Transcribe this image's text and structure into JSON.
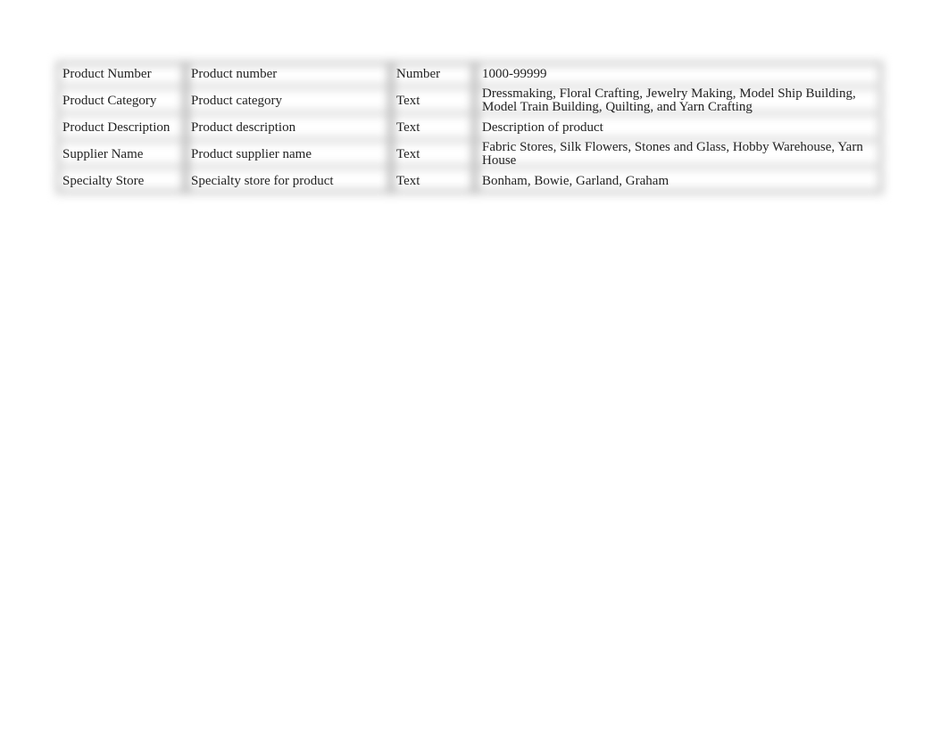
{
  "table": {
    "rows": [
      {
        "field": "Product Number",
        "description": "Product number",
        "type": "Number",
        "values": "1000-99999"
      },
      {
        "field": "Product Category",
        "description": "Product category",
        "type": "Text",
        "values": "Dressmaking, Floral Crafting, Jewelry Making, Model Ship Building, Model Train Building, Quilting, and Yarn Crafting"
      },
      {
        "field": "Product Description",
        "description": "Product description",
        "type": "Text",
        "values": "Description of product"
      },
      {
        "field": "Supplier Name",
        "description": "Product supplier name",
        "type": "Text",
        "values": "Fabric Stores, Silk Flowers, Stones and Glass, Hobby Warehouse, Yarn House"
      },
      {
        "field": "Specialty Store",
        "description": "Specialty store for product",
        "type": "Text",
        "values": "Bonham, Bowie, Garland, Graham"
      }
    ]
  }
}
